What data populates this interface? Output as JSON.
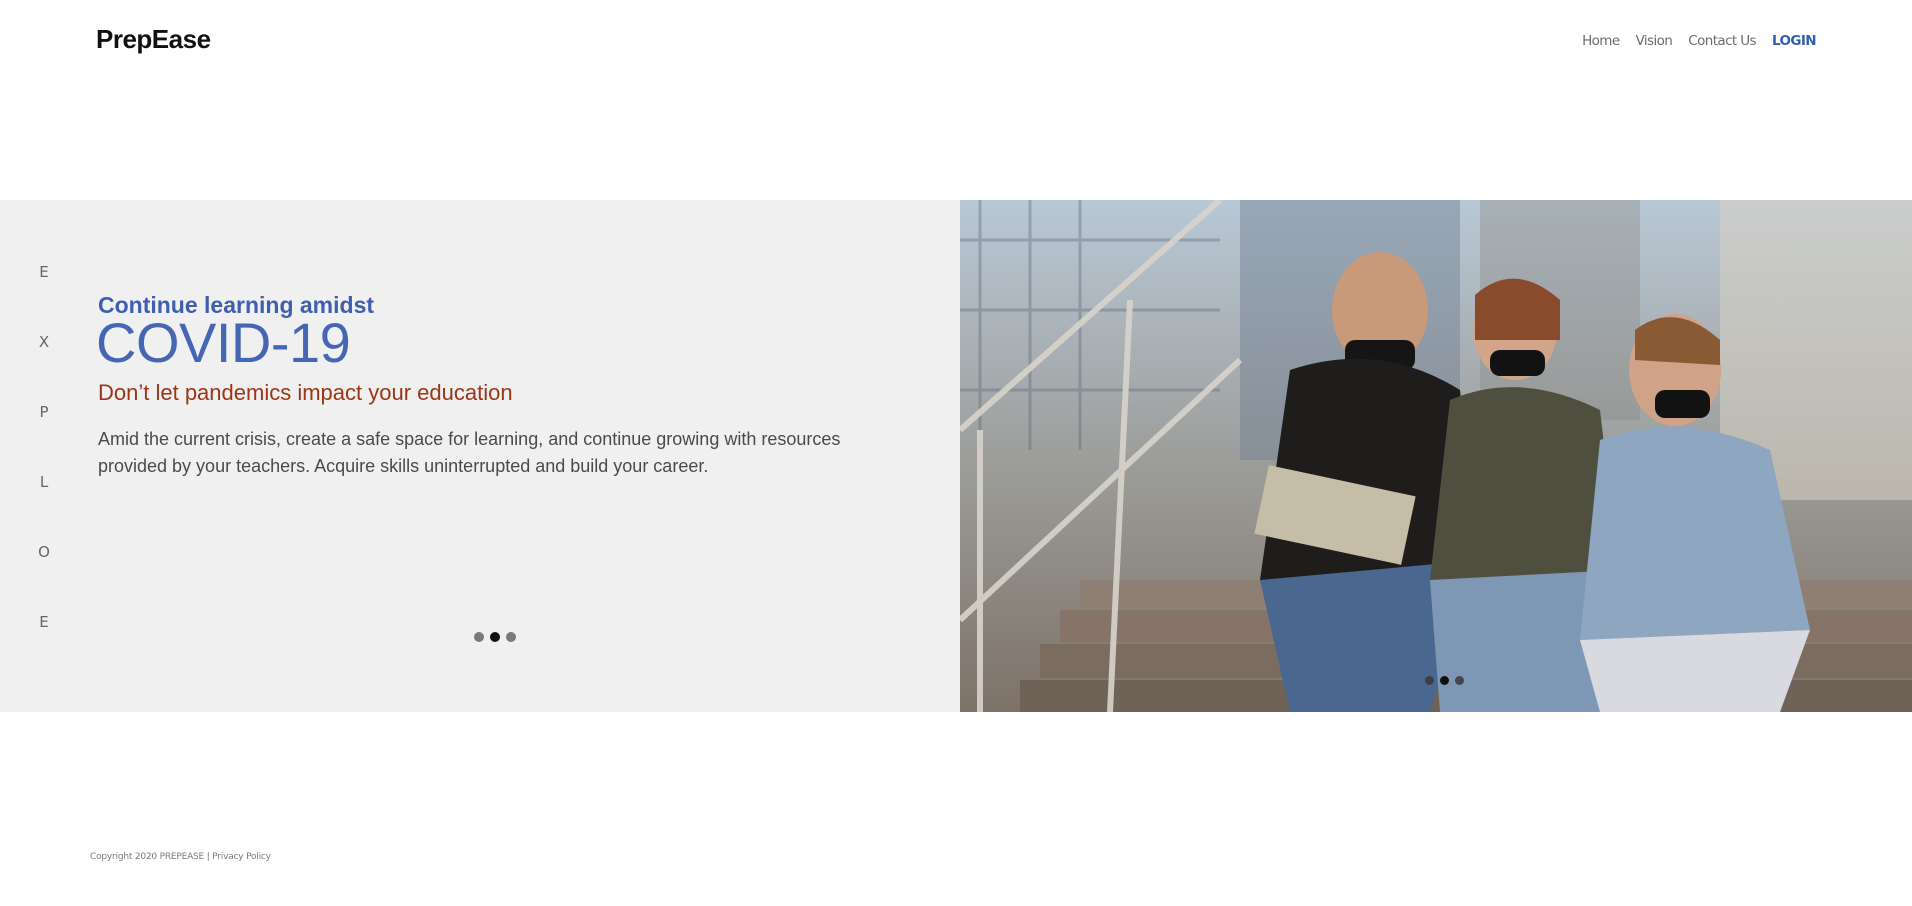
{
  "brand": {
    "name": "PrepEase"
  },
  "nav": {
    "items": [
      {
        "label": "Home"
      },
      {
        "label": "Vision"
      },
      {
        "label": "Contact Us"
      },
      {
        "label": "LOGIN"
      }
    ]
  },
  "sidebar": {
    "explore_letters": [
      "E",
      "X",
      "P",
      "L",
      "O",
      "E"
    ]
  },
  "hero": {
    "kicker": "Continue learning amidst",
    "headline": "COVID-19",
    "subhead": "Don’t let pandemics impact your education",
    "body": "Amid the current crisis, create a safe space for learning, and continue growing with resources provided by your teachers. Acquire skills uninterrupted and build your career.",
    "carousel": {
      "slide_count": 3,
      "active_index": 1
    }
  },
  "footer": {
    "copyright": "Copyright 2020 PREPEASE |",
    "privacy_label": "Privacy Policy"
  },
  "colors": {
    "accent": "#2f5fb3",
    "headline": "#4566b3",
    "subhead": "#9a3516",
    "panel": "#f0f0f0"
  }
}
